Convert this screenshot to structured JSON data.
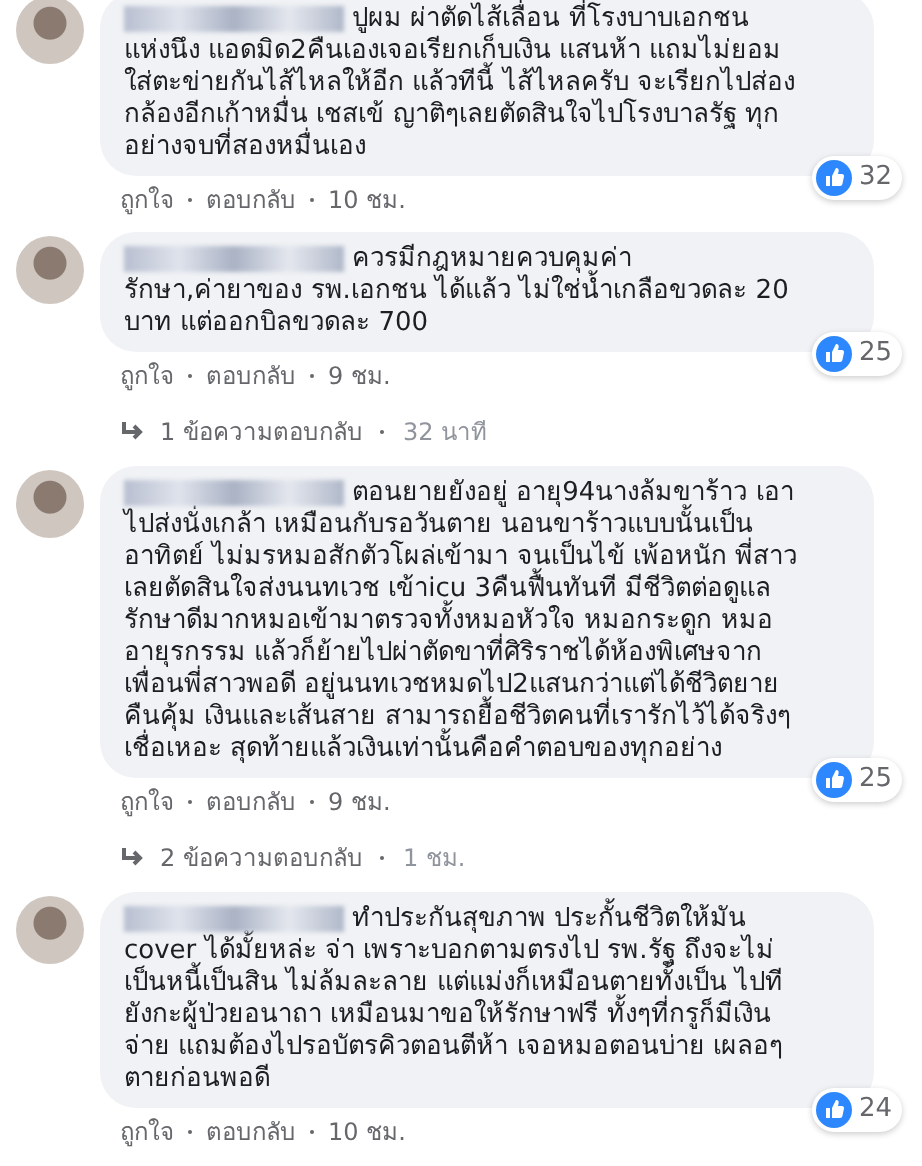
{
  "comments": [
    {
      "lines": [
        "ปูผม ผ่าตัดไส้เลื่อน ที่โรงบาบเอกชน",
        "แห่งนึง แอดมิด2คืนเองเจอเรียกเก็บเงิน แสนห้า แถมไม่ยอม",
        "ใส่ตะข่ายกันไส้ไหลให้อีก แล้วทีนี้ ไส้ไหลครับ จะเรียกไปส่อง",
        "กล้องอีกเก้าหมื่น เชสเข้ ญาติๆเลยตัดสินใจไปโรงบาลรัฐ ทุก",
        "อย่างจบที่สองหมื่นเอง"
      ],
      "likes": "32",
      "like_label": "ถูกใจ",
      "reply_label": "ตอบกลับ",
      "time": "10 ชม."
    },
    {
      "lines": [
        "ควรมีกฎหมายควบคุมค่า",
        "รักษา,ค่ายาของ รพ.เอกชน ได้แล้ว ไม่ใช่น้ำเกลือขวดละ 20",
        "บาท แต่ออกบิลขวดละ 700"
      ],
      "likes": "25",
      "like_label": "ถูกใจ",
      "reply_label": "ตอบกลับ",
      "time": "9 ชม.",
      "replies": {
        "label": "1 ข้อความตอบกลับ",
        "time": "32 นาที"
      }
    },
    {
      "lines": [
        "ตอนยายยังอยู่ อายุ94นางล้มขาร้าว เอา",
        "ไปส่งนั่งเกล้า เหมือนกับรอวันตาย นอนขาร้าวแบบนั้นเป็น",
        "อาทิตย์ ไม่มรหมอสักตัวโผล่เข้ามา จนเป็นไข้ เพ้อหนัก พี่สาว",
        "เลยตัดสินใจส่งนนทเวช เข้าicu 3คืนฟื้นทันที มีชีวิตต่อดูแล",
        "รักษาดีมากหมอเข้ามาตรวจทั้งหมอหัวใจ หมอกระดูก หมอ",
        "อายุรกรรม แล้วก็ย้ายไปผ่าตัดขาที่ศิริราชได้ห้องพิเศษจาก",
        "เพื่อนพี่สาวพอดี อยู่นนทเวชหมดไป2แสนกว่าแต่ได้ชีวิตยาย",
        "คืนคุ้ม เงินและเส้นสาย สามารถยื้อชีวิตคนที่เรารักไว้ได้จริงๆ",
        "เชื่อเหอะ สุดท้ายแล้วเงินเท่านั้นคือคำตอบของทุกอย่าง"
      ],
      "likes": "25",
      "like_label": "ถูกใจ",
      "reply_label": "ตอบกลับ",
      "time": "9 ชม.",
      "replies": {
        "label": "2 ข้อความตอบกลับ",
        "time": "1 ชม."
      }
    },
    {
      "lines": [
        "ทำประกันสุขภาพ ประกั้นชีวิตให้มัน",
        "cover ได้มั้ยหล่ะ จ่า เพราะบอกตามตรงไป รพ.รัฐ ถึงจะไม่",
        "เป็นหนี้เป็นสิน ไม่ล้มละลาย แต่แม่งก็เหมือนตายทั้งเป็น ไปที",
        "ยังกะผู้ป่วยอนาถา เหมือนมาขอให้รักษาฟรี ทั้งๆที่กรูก็มีเงิน",
        "จ่าย แถมต้องไปรอบัตรคิวตอนตีห้า เจอหมอตอนบ่าย เผลอๆ",
        "ตายก่อนพอดี"
      ],
      "likes": "24",
      "like_label": "ถูกใจ",
      "reply_label": "ตอบกลับ",
      "time": "10 ชม."
    }
  ]
}
